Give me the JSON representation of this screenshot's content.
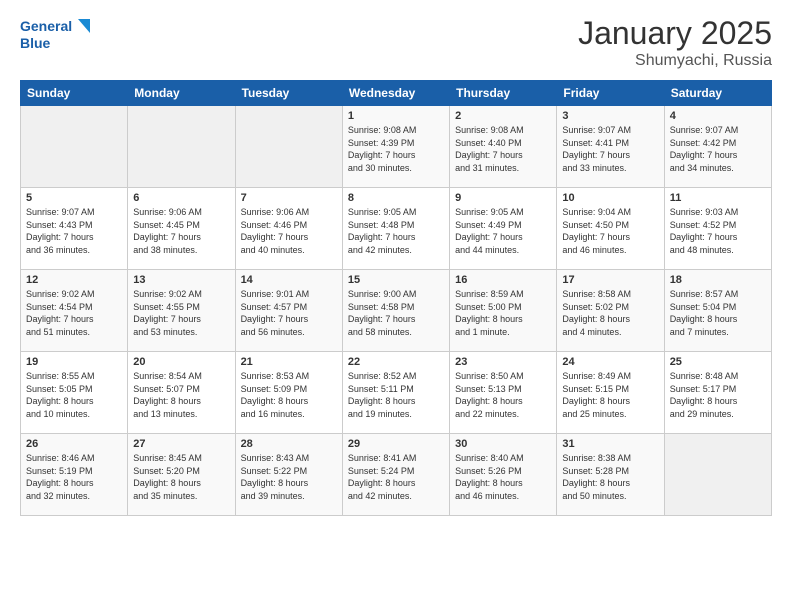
{
  "logo": {
    "line1": "General",
    "line2": "Blue"
  },
  "title": "January 2025",
  "location": "Shumyachi, Russia",
  "days_of_week": [
    "Sunday",
    "Monday",
    "Tuesday",
    "Wednesday",
    "Thursday",
    "Friday",
    "Saturday"
  ],
  "weeks": [
    [
      {
        "num": "",
        "info": ""
      },
      {
        "num": "",
        "info": ""
      },
      {
        "num": "",
        "info": ""
      },
      {
        "num": "1",
        "info": "Sunrise: 9:08 AM\nSunset: 4:39 PM\nDaylight: 7 hours\nand 30 minutes."
      },
      {
        "num": "2",
        "info": "Sunrise: 9:08 AM\nSunset: 4:40 PM\nDaylight: 7 hours\nand 31 minutes."
      },
      {
        "num": "3",
        "info": "Sunrise: 9:07 AM\nSunset: 4:41 PM\nDaylight: 7 hours\nand 33 minutes."
      },
      {
        "num": "4",
        "info": "Sunrise: 9:07 AM\nSunset: 4:42 PM\nDaylight: 7 hours\nand 34 minutes."
      }
    ],
    [
      {
        "num": "5",
        "info": "Sunrise: 9:07 AM\nSunset: 4:43 PM\nDaylight: 7 hours\nand 36 minutes."
      },
      {
        "num": "6",
        "info": "Sunrise: 9:06 AM\nSunset: 4:45 PM\nDaylight: 7 hours\nand 38 minutes."
      },
      {
        "num": "7",
        "info": "Sunrise: 9:06 AM\nSunset: 4:46 PM\nDaylight: 7 hours\nand 40 minutes."
      },
      {
        "num": "8",
        "info": "Sunrise: 9:05 AM\nSunset: 4:48 PM\nDaylight: 7 hours\nand 42 minutes."
      },
      {
        "num": "9",
        "info": "Sunrise: 9:05 AM\nSunset: 4:49 PM\nDaylight: 7 hours\nand 44 minutes."
      },
      {
        "num": "10",
        "info": "Sunrise: 9:04 AM\nSunset: 4:50 PM\nDaylight: 7 hours\nand 46 minutes."
      },
      {
        "num": "11",
        "info": "Sunrise: 9:03 AM\nSunset: 4:52 PM\nDaylight: 7 hours\nand 48 minutes."
      }
    ],
    [
      {
        "num": "12",
        "info": "Sunrise: 9:02 AM\nSunset: 4:54 PM\nDaylight: 7 hours\nand 51 minutes."
      },
      {
        "num": "13",
        "info": "Sunrise: 9:02 AM\nSunset: 4:55 PM\nDaylight: 7 hours\nand 53 minutes."
      },
      {
        "num": "14",
        "info": "Sunrise: 9:01 AM\nSunset: 4:57 PM\nDaylight: 7 hours\nand 56 minutes."
      },
      {
        "num": "15",
        "info": "Sunrise: 9:00 AM\nSunset: 4:58 PM\nDaylight: 7 hours\nand 58 minutes."
      },
      {
        "num": "16",
        "info": "Sunrise: 8:59 AM\nSunset: 5:00 PM\nDaylight: 8 hours\nand 1 minute."
      },
      {
        "num": "17",
        "info": "Sunrise: 8:58 AM\nSunset: 5:02 PM\nDaylight: 8 hours\nand 4 minutes."
      },
      {
        "num": "18",
        "info": "Sunrise: 8:57 AM\nSunset: 5:04 PM\nDaylight: 8 hours\nand 7 minutes."
      }
    ],
    [
      {
        "num": "19",
        "info": "Sunrise: 8:55 AM\nSunset: 5:05 PM\nDaylight: 8 hours\nand 10 minutes."
      },
      {
        "num": "20",
        "info": "Sunrise: 8:54 AM\nSunset: 5:07 PM\nDaylight: 8 hours\nand 13 minutes."
      },
      {
        "num": "21",
        "info": "Sunrise: 8:53 AM\nSunset: 5:09 PM\nDaylight: 8 hours\nand 16 minutes."
      },
      {
        "num": "22",
        "info": "Sunrise: 8:52 AM\nSunset: 5:11 PM\nDaylight: 8 hours\nand 19 minutes."
      },
      {
        "num": "23",
        "info": "Sunrise: 8:50 AM\nSunset: 5:13 PM\nDaylight: 8 hours\nand 22 minutes."
      },
      {
        "num": "24",
        "info": "Sunrise: 8:49 AM\nSunset: 5:15 PM\nDaylight: 8 hours\nand 25 minutes."
      },
      {
        "num": "25",
        "info": "Sunrise: 8:48 AM\nSunset: 5:17 PM\nDaylight: 8 hours\nand 29 minutes."
      }
    ],
    [
      {
        "num": "26",
        "info": "Sunrise: 8:46 AM\nSunset: 5:19 PM\nDaylight: 8 hours\nand 32 minutes."
      },
      {
        "num": "27",
        "info": "Sunrise: 8:45 AM\nSunset: 5:20 PM\nDaylight: 8 hours\nand 35 minutes."
      },
      {
        "num": "28",
        "info": "Sunrise: 8:43 AM\nSunset: 5:22 PM\nDaylight: 8 hours\nand 39 minutes."
      },
      {
        "num": "29",
        "info": "Sunrise: 8:41 AM\nSunset: 5:24 PM\nDaylight: 8 hours\nand 42 minutes."
      },
      {
        "num": "30",
        "info": "Sunrise: 8:40 AM\nSunset: 5:26 PM\nDaylight: 8 hours\nand 46 minutes."
      },
      {
        "num": "31",
        "info": "Sunrise: 8:38 AM\nSunset: 5:28 PM\nDaylight: 8 hours\nand 50 minutes."
      },
      {
        "num": "",
        "info": ""
      }
    ]
  ]
}
